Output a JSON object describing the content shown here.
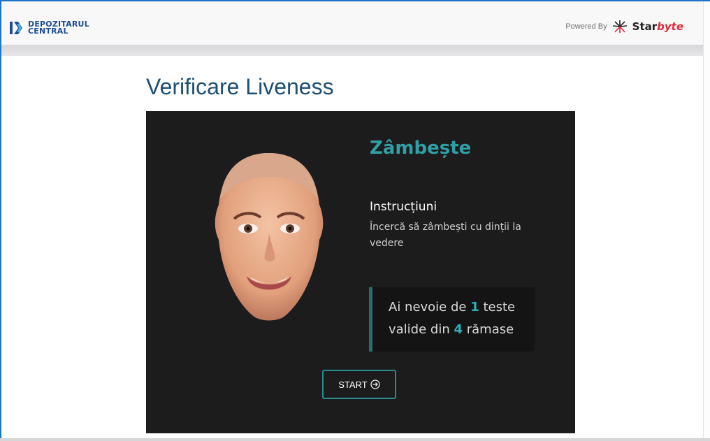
{
  "header": {
    "logo_line1": "DEPOZITARUL",
    "logo_line2": "CENTRAL",
    "powered_label": "Powered By",
    "brand_star": "Star",
    "brand_byte": "byte"
  },
  "page": {
    "title": "Verificare Liveness"
  },
  "challenge": {
    "action_title": "Zâmbește",
    "instructions_label": "Instrucțiuni",
    "instructions_text": "Încercă să zâmbești cu dinții la vedere",
    "tests": {
      "prefix": "Ai nevoie de",
      "needed": "1",
      "middle1": "teste",
      "middle2": "valide din",
      "remaining": "4",
      "suffix": "rămase"
    },
    "start_label": "START"
  },
  "colors": {
    "accent": "#2fa0a6",
    "panel": "#1c1c1d",
    "title": "#1e4f75",
    "brand_red": "#e02a3c"
  },
  "icons": {
    "logo": "depozitarul-logo-icon",
    "starbyte": "starbyte-burst-icon",
    "start": "arrow-circle-right-icon"
  }
}
